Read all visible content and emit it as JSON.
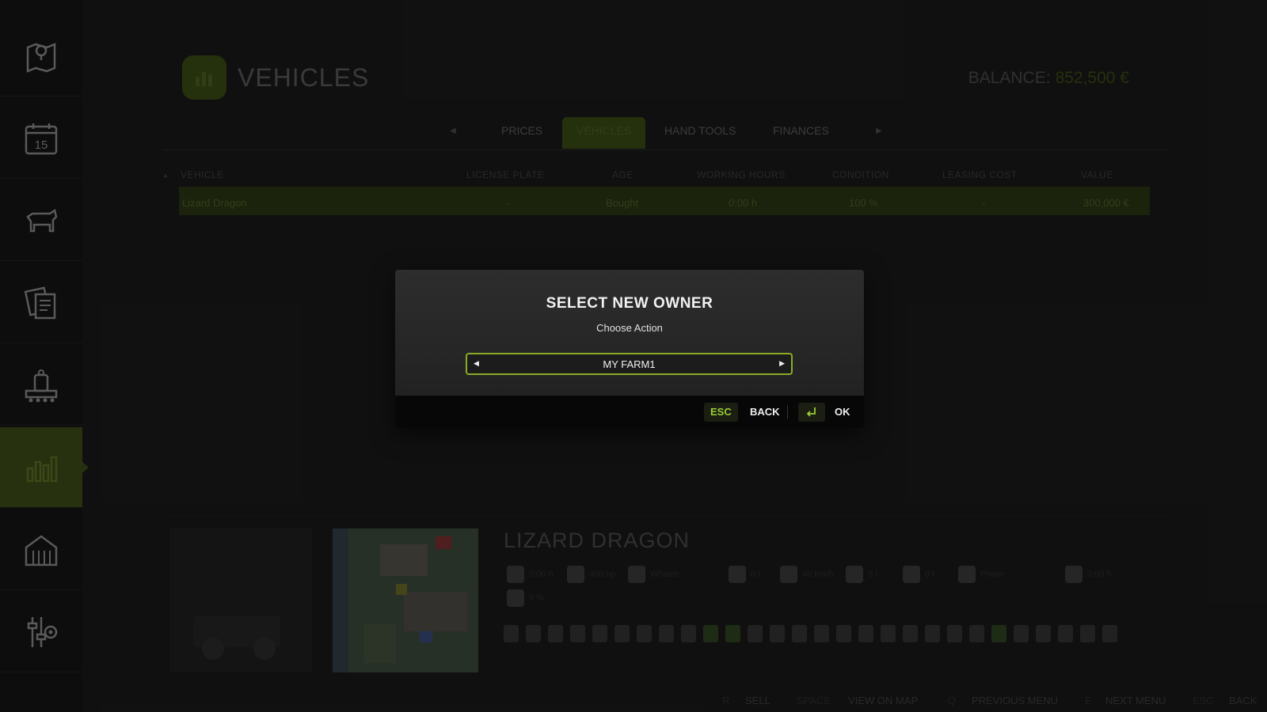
{
  "sidebar": {
    "items": [
      {
        "icon": "map-pin-icon",
        "active": false
      },
      {
        "icon": "calendar-icon",
        "active": false,
        "text": "15"
      },
      {
        "icon": "cow-icon",
        "active": false
      },
      {
        "icon": "contracts-icon",
        "active": false
      },
      {
        "icon": "production-icon",
        "active": false
      },
      {
        "icon": "statistics-icon",
        "active": true
      },
      {
        "icon": "barn-icon",
        "active": false
      },
      {
        "icon": "settings-icon",
        "active": false
      }
    ]
  },
  "header": {
    "title": "VEHICLES",
    "balance_label": "BALANCE:",
    "balance_value": "852,500 €"
  },
  "tabs": {
    "items": [
      "PRICES",
      "VEHICLES",
      "HAND TOOLS",
      "FINANCES"
    ],
    "active": "VEHICLES"
  },
  "table": {
    "columns": [
      "VEHICLE",
      "LICENSE PLATE",
      "AGE",
      "WORKING HOURS",
      "CONDITION",
      "LEASING COST",
      "VALUE"
    ],
    "rows": [
      {
        "vehicle": "Lizard Dragon",
        "license_plate": "-",
        "age": "Bought",
        "working_hours": "0:00 h",
        "condition": "100 %",
        "leasing_cost": "-",
        "value": "300,000 €"
      }
    ]
  },
  "detail": {
    "name": "LIZARD DRAGON",
    "specs": [
      {
        "icon": "hourglass-icon",
        "label": "0:00 h"
      },
      {
        "icon": "engine-icon",
        "label": "400 hp"
      },
      {
        "icon": "tire-icon",
        "label": "Wheels"
      },
      {
        "icon": "fuel-icon",
        "label": "0 l"
      },
      {
        "icon": "speedometer-icon",
        "label": "40 km/h"
      },
      {
        "icon": "tank-icon",
        "label": "0 l"
      },
      {
        "icon": "weight-icon",
        "label": "0 t"
      },
      {
        "icon": "gear-icon",
        "label": "Power"
      },
      {
        "icon": "clock-icon",
        "label": "0:00 h"
      }
    ],
    "wrench_label": "0 %"
  },
  "bottom_hints": [
    {
      "key": "R",
      "label": "SELL"
    },
    {
      "key": "SPACE",
      "label": "VIEW ON MAP"
    },
    {
      "key": "Q",
      "label": "PREVIOUS MENU"
    },
    {
      "key": "E",
      "label": "NEXT MENU"
    },
    {
      "key": "ESC",
      "label": "BACK"
    }
  ],
  "dialog": {
    "title": "SELECT NEW OWNER",
    "subtitle": "Choose Action",
    "selected_owner": "MY FARM1",
    "back_key": "ESC",
    "back_label": "BACK",
    "ok_label": "OK",
    "accent_color": "#8aac2a"
  }
}
